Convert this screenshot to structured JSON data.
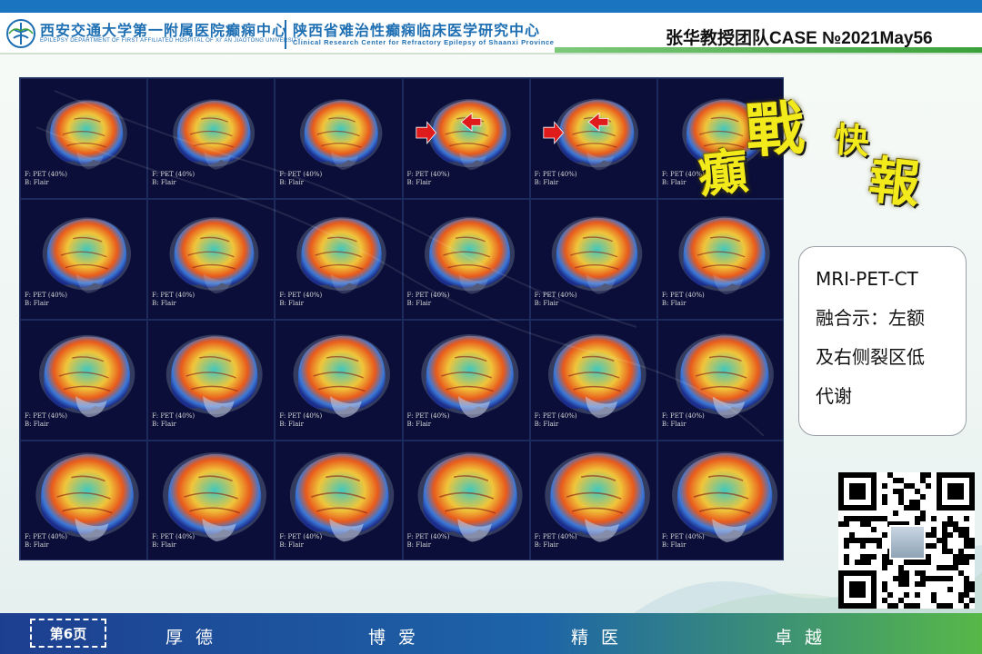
{
  "header": {
    "brand_cn": "西安交通大学第一附属医院癫痫中心",
    "brand_en": "EPILEPSY DEPARTMENT OF FIRST AFFILIATED HOSPITAL OF XI' AN JIAOTONG UNIVERSITY",
    "center_cn": "陕西省难治性癫痫临床医学研究中心",
    "center_en": "Clinical Research Center for Refractory Epilepsy of Shaanxi Province",
    "case_title": "张华教授团队CASE №2021May56",
    "accent_color": "#1f6fb3",
    "top_bar_color": "#1a74c0"
  },
  "scans": {
    "rows": 4,
    "cols": 6,
    "label_f": "F: PET (40%)",
    "label_b": "B: Flair",
    "arrow_color": "#e01b1b",
    "arrow_cells": [
      3,
      4
    ]
  },
  "calligraphy": {
    "chars": [
      "癲",
      "戰",
      "快",
      "報"
    ],
    "color": "#f3ea1b"
  },
  "finding": {
    "lines": [
      "MRI-PET-CT",
      "融合示：左额",
      "及右侧裂区低",
      "代谢"
    ]
  },
  "footer": {
    "page_label": "第6页",
    "mottos": [
      "厚德",
      "博爱",
      "精医",
      "卓越"
    ]
  }
}
